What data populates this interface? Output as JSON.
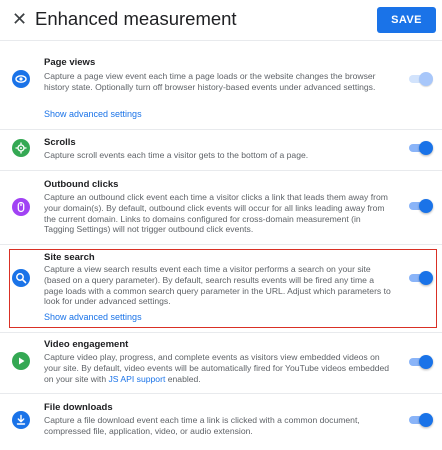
{
  "header": {
    "close_glyph": "✕",
    "title": "Enhanced measurement",
    "save_label": "SAVE"
  },
  "sections": [
    {
      "title": "Page views",
      "description": "Capture a page view event each time a page loads or the website changes the browser history state. Optionally turn off browser history-based events under advanced settings.",
      "advanced_link": "Show advanced settings",
      "icon": "eye-icon",
      "icon_color": "#1a73e8",
      "toggle": "on-disabled"
    },
    {
      "title": "Scrolls",
      "description": "Capture scroll events each time a visitor gets to the bottom of a page.",
      "icon": "crosshair-icon",
      "icon_color": "#34a853",
      "toggle": "on"
    },
    {
      "title": "Outbound clicks",
      "description": "Capture an outbound click event each time a visitor clicks a link that leads them away from your domain(s). By default, outbound click events will occur for all links leading away from the current domain. Links to domains configured for cross-domain measurement (in Tagging Settings) will not trigger outbound click events.",
      "icon": "mouse-icon",
      "icon_color": "#a142f4",
      "toggle": "on"
    },
    {
      "title": "Site search",
      "description": "Capture a view search results event each time a visitor performs a search on your site (based on a query parameter). By default, search results events will be fired any time a page loads with a common search query parameter in the URL. Adjust which parameters to look for under advanced settings.",
      "advanced_link": "Show advanced settings",
      "icon": "search-icon",
      "icon_color": "#1a73e8",
      "toggle": "on"
    },
    {
      "title": "Video engagement",
      "description_before": "Capture video play, progress, and complete events as visitors view embedded videos on your site. By default, video events will be automatically fired for YouTube videos embedded on your site with ",
      "description_link": "JS API support",
      "description_after": " enabled.",
      "icon": "play-icon",
      "icon_color": "#34a853",
      "toggle": "on"
    },
    {
      "title": "File downloads",
      "description": "Capture a file download event each time a link is clicked with a common document, compressed file, application, video, or audio extension.",
      "icon": "download-icon",
      "icon_color": "#1a73e8",
      "toggle": "on"
    }
  ]
}
